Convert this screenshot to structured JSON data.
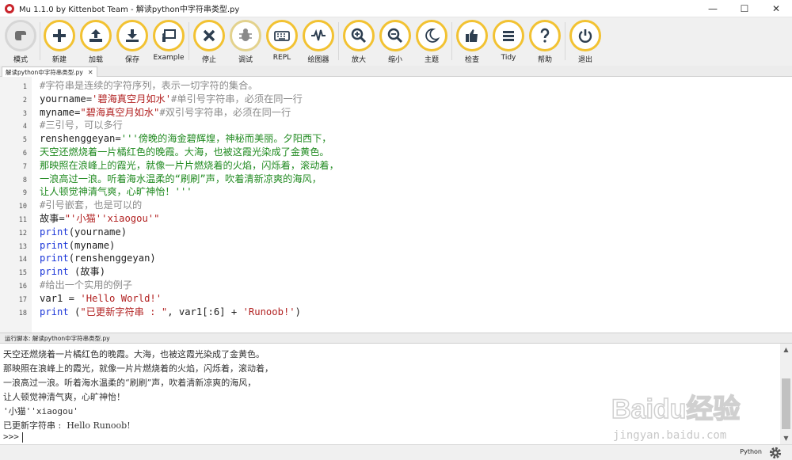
{
  "window": {
    "title": "Mu 1.1.0 by Kittenbot Team - 解读python中字符串类型.py",
    "controls": [
      "—",
      "☐",
      "✕"
    ]
  },
  "toolbar": {
    "buttons": [
      {
        "label": "模式",
        "icon": "mode-icon"
      },
      {
        "label": "新建",
        "icon": "plus-icon"
      },
      {
        "label": "加载",
        "icon": "upload-icon"
      },
      {
        "label": "保存",
        "icon": "download-icon"
      },
      {
        "label": "Example",
        "icon": "presentation-icon"
      },
      {
        "label": "停止",
        "icon": "close-icon"
      },
      {
        "label": "调试",
        "icon": "bug-icon"
      },
      {
        "label": "REPL",
        "icon": "keyboard-icon"
      },
      {
        "label": "绘图器",
        "icon": "pulse-icon"
      },
      {
        "label": "放大",
        "icon": "zoom-in-icon"
      },
      {
        "label": "缩小",
        "icon": "zoom-out-icon"
      },
      {
        "label": "主题",
        "icon": "moon-icon"
      },
      {
        "label": "检查",
        "icon": "thumbs-up-icon"
      },
      {
        "label": "Tidy",
        "icon": "tidy-lines-icon"
      },
      {
        "label": "帮助",
        "icon": "question-icon"
      },
      {
        "label": "退出",
        "icon": "power-icon"
      }
    ]
  },
  "editor": {
    "tab_label": "解读python中字符串类型.py",
    "tab_close": "✕",
    "line_numbers": [
      "1",
      "2",
      "3",
      "4",
      "5",
      "6",
      "7",
      "8",
      "9",
      "10",
      "11",
      "12",
      "13",
      "14",
      "15",
      "16",
      "17",
      "18"
    ],
    "lines": [
      [
        {
          "t": "#字符串是连续的字符序列，表示一切字符的集合。",
          "c": "com"
        }
      ],
      [
        {
          "t": "yourname=",
          "c": "txt"
        },
        {
          "t": "'碧海真空月如水'",
          "c": "str"
        },
        {
          "t": "#单引号字符串，必须在同一行",
          "c": "com"
        }
      ],
      [
        {
          "t": "myname=",
          "c": "txt"
        },
        {
          "t": "\"碧海真空月如水\"",
          "c": "str"
        },
        {
          "t": "#双引号字符串，必须在同一行",
          "c": "com"
        }
      ],
      [
        {
          "t": "#三引号，可以多行",
          "c": "com"
        }
      ],
      [
        {
          "t": "renshenggeyan=",
          "c": "txt"
        },
        {
          "t": "'''傍晚的海金碧辉煌，神秘而美丽。夕阳西下，",
          "c": "doc"
        }
      ],
      [
        {
          "t": "天空还燃烧着一片橘红色的晚霞。大海，也被这霞光染成了金黄色。",
          "c": "doc"
        }
      ],
      [
        {
          "t": "那映照在浪峰上的霞光，就像一片片燃烧着的火焰，闪烁着，滚动着，",
          "c": "doc"
        }
      ],
      [
        {
          "t": "一浪高过一浪。听着海水温柔的“刷刷”声，吹着清新凉爽的海风，",
          "c": "doc"
        }
      ],
      [
        {
          "t": "让人顿觉神清气爽，心旷神怡！'''",
          "c": "doc"
        }
      ],
      [
        {
          "t": "#引号嵌套，也是可以的",
          "c": "com"
        }
      ],
      [
        {
          "t": "故事=",
          "c": "txt"
        },
        {
          "t": "\"'小猫''xiaogou'\"",
          "c": "str"
        }
      ],
      [
        {
          "t": "print",
          "c": "kw"
        },
        {
          "t": "(yourname)",
          "c": "txt"
        }
      ],
      [
        {
          "t": "print",
          "c": "kw"
        },
        {
          "t": "(myname)",
          "c": "txt"
        }
      ],
      [
        {
          "t": "print",
          "c": "kw"
        },
        {
          "t": "(renshenggeyan)",
          "c": "txt"
        }
      ],
      [
        {
          "t": "print",
          "c": "kw"
        },
        {
          "t": " (故事)",
          "c": "txt"
        }
      ],
      [
        {
          "t": "#给出一个实用的例子",
          "c": "com"
        }
      ],
      [
        {
          "t": "var1 = ",
          "c": "txt"
        },
        {
          "t": "'Hello World!'",
          "c": "str"
        }
      ],
      [
        {
          "t": "print",
          "c": "kw"
        },
        {
          "t": " (",
          "c": "txt"
        },
        {
          "t": "\"已更新字符串 : \"",
          "c": "str"
        },
        {
          "t": ", var1[:6] + ",
          "c": "txt"
        },
        {
          "t": "'Runoob!'",
          "c": "str"
        },
        {
          "t": ")",
          "c": "txt"
        }
      ]
    ]
  },
  "runner": {
    "label": "运行脚本: 解读python中字符串类型.py",
    "output_lines": [
      "天空还燃烧着一片橘红色的晚霞。大海，也被这霞光染成了金黄色。",
      "那映照在浪峰上的霞光，就像一片片燃烧着的火焰，闪烁着，滚动着，",
      "一浪高过一浪。听着海水温柔的“刷刷”声，吹着清新凉爽的海风，",
      "让人顿觉神清气爽，心旷神怡！",
      "'小猫''xiaogou'",
      "已更新字符串 :  Hello Runoob!"
    ],
    "prompt": ">>>",
    "scroll_up": "▲",
    "scroll_down": "▼"
  },
  "statusbar": {
    "mode": "Python"
  },
  "watermark": {
    "brand": "Baidu经验",
    "url": "jingyan.baidu.com"
  },
  "colors": {
    "button_ring": "#f2c232",
    "comment": "#8a8a8a",
    "string": "#b22222",
    "docstring": "#228b22",
    "keyword": "#1a35d8"
  }
}
